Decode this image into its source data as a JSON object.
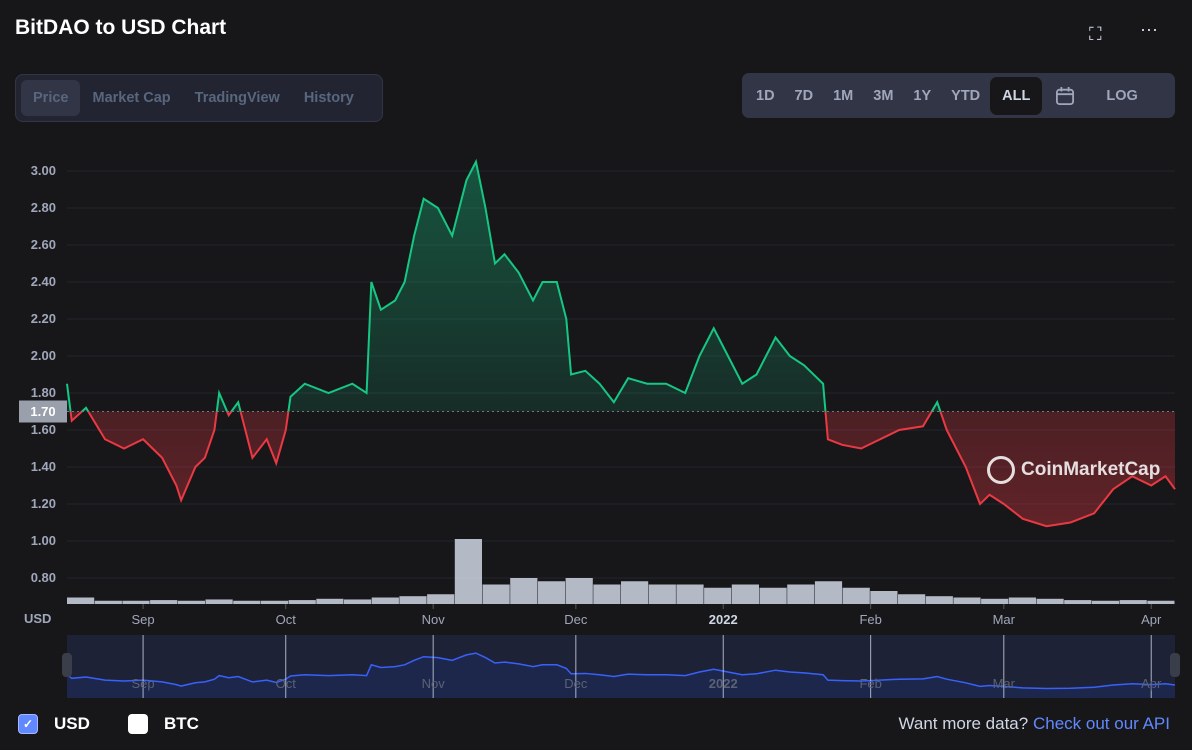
{
  "title": "BitDAO to USD Chart",
  "header_icons": [
    "fullscreen-icon",
    "more-icon"
  ],
  "tabs": [
    {
      "label": "Price",
      "active": true
    },
    {
      "label": "Market Cap"
    },
    {
      "label": "TradingView"
    },
    {
      "label": "History"
    }
  ],
  "ranges": [
    {
      "label": "1D"
    },
    {
      "label": "7D"
    },
    {
      "label": "1M"
    },
    {
      "label": "3M"
    },
    {
      "label": "1Y"
    },
    {
      "label": "YTD"
    },
    {
      "label": "ALL",
      "active": true
    }
  ],
  "log_label": "LOG",
  "currency_label": "USD",
  "watermark": "CoinMarketCap",
  "legend": {
    "usd": "USD",
    "btc": "BTC",
    "usd_checked": true,
    "btc_checked": false
  },
  "api_text": "Want more data?",
  "api_link": "Check out our API",
  "colors": {
    "up": "#16c784",
    "down": "#ea3943",
    "navigator": "#3861fb",
    "background": "#17171a"
  },
  "chart_data": {
    "type": "line",
    "title": "BitDAO to USD Chart",
    "ylabel": "USD",
    "ylim": [
      0.7,
      3.1
    ],
    "yticks": [
      "0.80",
      "1.00",
      "1.20",
      "1.40",
      "1.60",
      "1.80",
      "2.00",
      "2.20",
      "2.40",
      "2.60",
      "2.80",
      "3.00"
    ],
    "xlim": [
      "2021-08-16",
      "2022-04-06"
    ],
    "xticks": [
      {
        "label": "Sep",
        "date": "2021-09-01"
      },
      {
        "label": "Oct",
        "date": "2021-10-01"
      },
      {
        "label": "Nov",
        "date": "2021-11-01"
      },
      {
        "label": "Dec",
        "date": "2021-12-01"
      },
      {
        "label": "2022",
        "date": "2022-01-01"
      },
      {
        "label": "Feb",
        "date": "2022-02-01"
      },
      {
        "label": "Mar",
        "date": "2022-03-01"
      },
      {
        "label": "Apr",
        "date": "2022-04-01"
      }
    ],
    "baseline": {
      "label": "1.70",
      "value": 1.7
    },
    "grid": true,
    "series": [
      {
        "points": [
          [
            "2021-08-16",
            1.85
          ],
          [
            "2021-08-17",
            1.65
          ],
          [
            "2021-08-20",
            1.72
          ],
          [
            "2021-08-24",
            1.55
          ],
          [
            "2021-08-28",
            1.5
          ],
          [
            "2021-09-01",
            1.55
          ],
          [
            "2021-09-05",
            1.45
          ],
          [
            "2021-09-08",
            1.3
          ],
          [
            "2021-09-09",
            1.22
          ],
          [
            "2021-09-12",
            1.4
          ],
          [
            "2021-09-14",
            1.45
          ],
          [
            "2021-09-16",
            1.6
          ],
          [
            "2021-09-17",
            1.8
          ],
          [
            "2021-09-19",
            1.68
          ],
          [
            "2021-09-21",
            1.75
          ],
          [
            "2021-09-24",
            1.45
          ],
          [
            "2021-09-27",
            1.55
          ],
          [
            "2021-09-29",
            1.42
          ],
          [
            "2021-10-01",
            1.6
          ],
          [
            "2021-10-02",
            1.78
          ],
          [
            "2021-10-05",
            1.85
          ],
          [
            "2021-10-10",
            1.8
          ],
          [
            "2021-10-15",
            1.85
          ],
          [
            "2021-10-18",
            1.8
          ],
          [
            "2021-10-19",
            2.4
          ],
          [
            "2021-10-21",
            2.25
          ],
          [
            "2021-10-24",
            2.3
          ],
          [
            "2021-10-26",
            2.4
          ],
          [
            "2021-10-28",
            2.65
          ],
          [
            "2021-10-30",
            2.85
          ],
          [
            "2021-11-02",
            2.8
          ],
          [
            "2021-11-05",
            2.65
          ],
          [
            "2021-11-08",
            2.95
          ],
          [
            "2021-11-10",
            3.05
          ],
          [
            "2021-11-12",
            2.8
          ],
          [
            "2021-11-14",
            2.5
          ],
          [
            "2021-11-16",
            2.55
          ],
          [
            "2021-11-19",
            2.45
          ],
          [
            "2021-11-22",
            2.3
          ],
          [
            "2021-11-24",
            2.4
          ],
          [
            "2021-11-27",
            2.4
          ],
          [
            "2021-11-29",
            2.2
          ],
          [
            "2021-11-30",
            1.9
          ],
          [
            "2021-12-03",
            1.92
          ],
          [
            "2021-12-06",
            1.85
          ],
          [
            "2021-12-09",
            1.75
          ],
          [
            "2021-12-12",
            1.88
          ],
          [
            "2021-12-16",
            1.85
          ],
          [
            "2021-12-20",
            1.85
          ],
          [
            "2021-12-24",
            1.8
          ],
          [
            "2021-12-27",
            2.0
          ],
          [
            "2021-12-30",
            2.15
          ],
          [
            "2022-01-02",
            2.0
          ],
          [
            "2022-01-05",
            1.85
          ],
          [
            "2022-01-08",
            1.9
          ],
          [
            "2022-01-12",
            2.1
          ],
          [
            "2022-01-15",
            2.0
          ],
          [
            "2022-01-18",
            1.95
          ],
          [
            "2022-01-22",
            1.85
          ],
          [
            "2022-01-23",
            1.55
          ],
          [
            "2022-01-26",
            1.52
          ],
          [
            "2022-01-30",
            1.5
          ],
          [
            "2022-02-03",
            1.55
          ],
          [
            "2022-02-07",
            1.6
          ],
          [
            "2022-02-12",
            1.62
          ],
          [
            "2022-02-15",
            1.75
          ],
          [
            "2022-02-17",
            1.6
          ],
          [
            "2022-02-21",
            1.4
          ],
          [
            "2022-02-24",
            1.2
          ],
          [
            "2022-02-26",
            1.25
          ],
          [
            "2022-03-01",
            1.2
          ],
          [
            "2022-03-05",
            1.12
          ],
          [
            "2022-03-10",
            1.08
          ],
          [
            "2022-03-15",
            1.1
          ],
          [
            "2022-03-20",
            1.15
          ],
          [
            "2022-03-24",
            1.28
          ],
          [
            "2022-03-28",
            1.35
          ],
          [
            "2022-04-01",
            1.3
          ],
          [
            "2022-04-04",
            1.35
          ],
          [
            "2022-04-06",
            1.28
          ]
        ]
      }
    ],
    "volume_relative": [
      0.1,
      0.05,
      0.05,
      0.06,
      0.05,
      0.07,
      0.05,
      0.05,
      0.06,
      0.08,
      0.07,
      0.1,
      0.12,
      0.15,
      1.0,
      0.3,
      0.4,
      0.35,
      0.4,
      0.3,
      0.35,
      0.3,
      0.3,
      0.25,
      0.3,
      0.25,
      0.3,
      0.35,
      0.25,
      0.2,
      0.15,
      0.12,
      0.1,
      0.08,
      0.1,
      0.08,
      0.06,
      0.05,
      0.06,
      0.05
    ]
  }
}
